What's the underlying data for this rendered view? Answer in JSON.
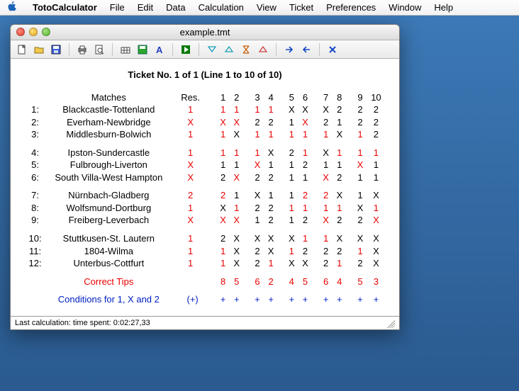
{
  "menubar": {
    "app": "TotoCalculator",
    "items": [
      "File",
      "Edit",
      "Data",
      "Calculation",
      "View",
      "Ticket",
      "Preferences",
      "Window",
      "Help"
    ]
  },
  "window": {
    "title": "example.tmt"
  },
  "content": {
    "ticket_title": "Ticket No. 1 of 1 (Line 1 to 10 of 10)",
    "matches_label": "Matches",
    "res_label": "Res.",
    "col_headers": [
      "1",
      "2",
      "3",
      "4",
      "5",
      "6",
      "7",
      "8",
      "9",
      "10"
    ],
    "groups": [
      [
        {
          "idx": "1:",
          "name": "Blackcastle-Tottenland",
          "res": "1",
          "cells": [
            "1",
            "1",
            "1",
            "1",
            "X",
            "X",
            "X",
            "2",
            "2",
            "2"
          ],
          "hi": [
            1,
            1,
            1,
            1,
            0,
            0,
            0,
            0,
            0,
            0
          ]
        },
        {
          "idx": "2:",
          "name": "Everham-Newbridge",
          "res": "X",
          "cells": [
            "X",
            "X",
            "2",
            "2",
            "1",
            "X",
            "2",
            "1",
            "2",
            "2"
          ],
          "hi": [
            1,
            1,
            0,
            0,
            0,
            1,
            0,
            0,
            0,
            0
          ]
        },
        {
          "idx": "3:",
          "name": "Middlesburn-Bolwich",
          "res": "1",
          "cells": [
            "1",
            "X",
            "1",
            "1",
            "1",
            "1",
            "1",
            "X",
            "1",
            "2"
          ],
          "hi": [
            1,
            0,
            1,
            1,
            1,
            1,
            1,
            0,
            1,
            0
          ]
        }
      ],
      [
        {
          "idx": "4:",
          "name": "Ipston-Sundercastle",
          "res": "1",
          "cells": [
            "1",
            "1",
            "1",
            "X",
            "2",
            "1",
            "X",
            "1",
            "1",
            "1"
          ],
          "hi": [
            1,
            1,
            1,
            0,
            0,
            1,
            0,
            1,
            1,
            1
          ]
        },
        {
          "idx": "5:",
          "name": "Fulbrough-Liverton",
          "res": "X",
          "cells": [
            "1",
            "1",
            "X",
            "1",
            "1",
            "2",
            "1",
            "1",
            "X",
            "1"
          ],
          "hi": [
            0,
            0,
            1,
            0,
            0,
            0,
            0,
            0,
            1,
            0
          ]
        },
        {
          "idx": "6:",
          "name": "South Villa-West Hampton",
          "res": "X",
          "cells": [
            "2",
            "X",
            "2",
            "2",
            "1",
            "1",
            "X",
            "2",
            "1",
            "1"
          ],
          "hi": [
            0,
            1,
            0,
            0,
            0,
            0,
            1,
            0,
            0,
            0
          ]
        }
      ],
      [
        {
          "idx": "7:",
          "name": "Nürnbach-Gladberg",
          "res": "2",
          "cells": [
            "2",
            "1",
            "X",
            "1",
            "1",
            "2",
            "2",
            "X",
            "1",
            "X"
          ],
          "hi": [
            1,
            0,
            0,
            0,
            0,
            1,
            1,
            0,
            0,
            0
          ]
        },
        {
          "idx": "8:",
          "name": "Wolfsmund-Dortburg",
          "res": "1",
          "cells": [
            "X",
            "1",
            "2",
            "2",
            "1",
            "1",
            "1",
            "1",
            "X",
            "1"
          ],
          "hi": [
            0,
            1,
            0,
            0,
            1,
            1,
            1,
            1,
            0,
            1
          ]
        },
        {
          "idx": "9:",
          "name": "Freiberg-Leverbach",
          "res": "X",
          "cells": [
            "X",
            "X",
            "1",
            "2",
            "1",
            "2",
            "X",
            "2",
            "2",
            "X"
          ],
          "hi": [
            1,
            1,
            0,
            0,
            0,
            0,
            1,
            0,
            0,
            1
          ]
        }
      ],
      [
        {
          "idx": "10:",
          "name": "Stuttkusen-St. Lautern",
          "res": "1",
          "cells": [
            "2",
            "X",
            "X",
            "X",
            "X",
            "1",
            "1",
            "X",
            "X",
            "X"
          ],
          "hi": [
            0,
            0,
            0,
            0,
            0,
            1,
            1,
            0,
            0,
            0
          ]
        },
        {
          "idx": "11:",
          "name": "1804-Wilma",
          "res": "1",
          "cells": [
            "1",
            "X",
            "2",
            "X",
            "1",
            "2",
            "2",
            "2",
            "1",
            "X"
          ],
          "hi": [
            1,
            0,
            0,
            0,
            1,
            0,
            0,
            0,
            1,
            0
          ]
        },
        {
          "idx": "12:",
          "name": "Unterbus-Cottfurt",
          "res": "1",
          "cells": [
            "1",
            "X",
            "2",
            "1",
            "X",
            "X",
            "2",
            "1",
            "2",
            "X"
          ],
          "hi": [
            1,
            0,
            0,
            1,
            0,
            0,
            0,
            1,
            0,
            0
          ]
        }
      ]
    ],
    "correct_label": "Correct Tips",
    "correct_values": [
      "8",
      "5",
      "6",
      "2",
      "4",
      "5",
      "6",
      "4",
      "5",
      "3"
    ],
    "cond_label": "Conditions for 1, X and 2",
    "cond_symbol": "(+)",
    "cond_values": [
      "+",
      "+",
      "+",
      "+",
      "+",
      "+",
      "+",
      "+",
      "+",
      "+"
    ]
  },
  "status": {
    "text": "Last calculation: time spent: 0:02:27,33"
  }
}
